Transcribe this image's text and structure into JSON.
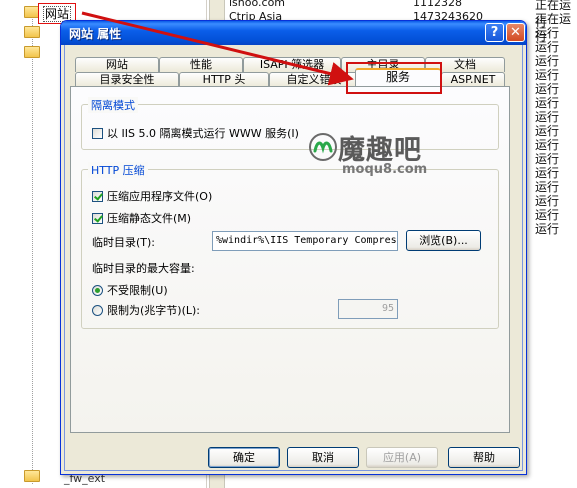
{
  "background": {
    "tree_label": "网站",
    "tree_bottom": "_fw_ext",
    "list_rows": [
      {
        "name": "ishoo.com",
        "id": "1112328"
      },
      {
        "name": "Ctrip Asia",
        "id": "1473243620"
      }
    ],
    "status_items": [
      "正在运行",
      "正在运行",
      "运行",
      "运行",
      "运行",
      "运行",
      "运行",
      "运行",
      "运行",
      "运行",
      "运行",
      "运行",
      "运行",
      "运行",
      "运行",
      "运行",
      "运行"
    ]
  },
  "dialog": {
    "title": "网站 属性",
    "help_button": "?",
    "close_button": "✕",
    "tabs_row1": [
      "网站",
      "性能",
      "ISAPI 筛选器",
      "主目录",
      "文档"
    ],
    "tabs_row2": [
      "目录安全性",
      "HTTP 头",
      "自定义错误",
      "服务",
      "ASP.NET"
    ],
    "isolation": {
      "title": "隔离模式",
      "checkbox_label": "以 IIS 5.0 隔离模式运行 WWW 服务(I)",
      "checked": false
    },
    "http_compression": {
      "title": "HTTP 压缩",
      "compress_app_label": "压缩应用程序文件(O)",
      "compress_app_checked": true,
      "compress_static_label": "压缩静态文件(M)",
      "compress_static_checked": true,
      "temp_dir_label": "临时目录(T):",
      "temp_dir_value": "%windir%\\IIS Temporary Compres",
      "browse_label": "浏览(B)...",
      "max_size_label": "临时目录的最大容量:",
      "unlimited_label": "不受限制(U)",
      "unlimited_selected": true,
      "limited_label": "限制为(兆字节)(L):",
      "limit_value": "95"
    },
    "buttons": {
      "ok": "确定",
      "cancel": "取消",
      "apply": "应用(A)",
      "help": "帮助"
    }
  },
  "watermark": {
    "text": "魔趣吧",
    "sub": "moqu8.com"
  },
  "colors": {
    "title_bar": "#0351d8",
    "annotation_red": "#d01010",
    "group_title": "#0046d5",
    "active_tab_accent": "#f1a92b"
  }
}
